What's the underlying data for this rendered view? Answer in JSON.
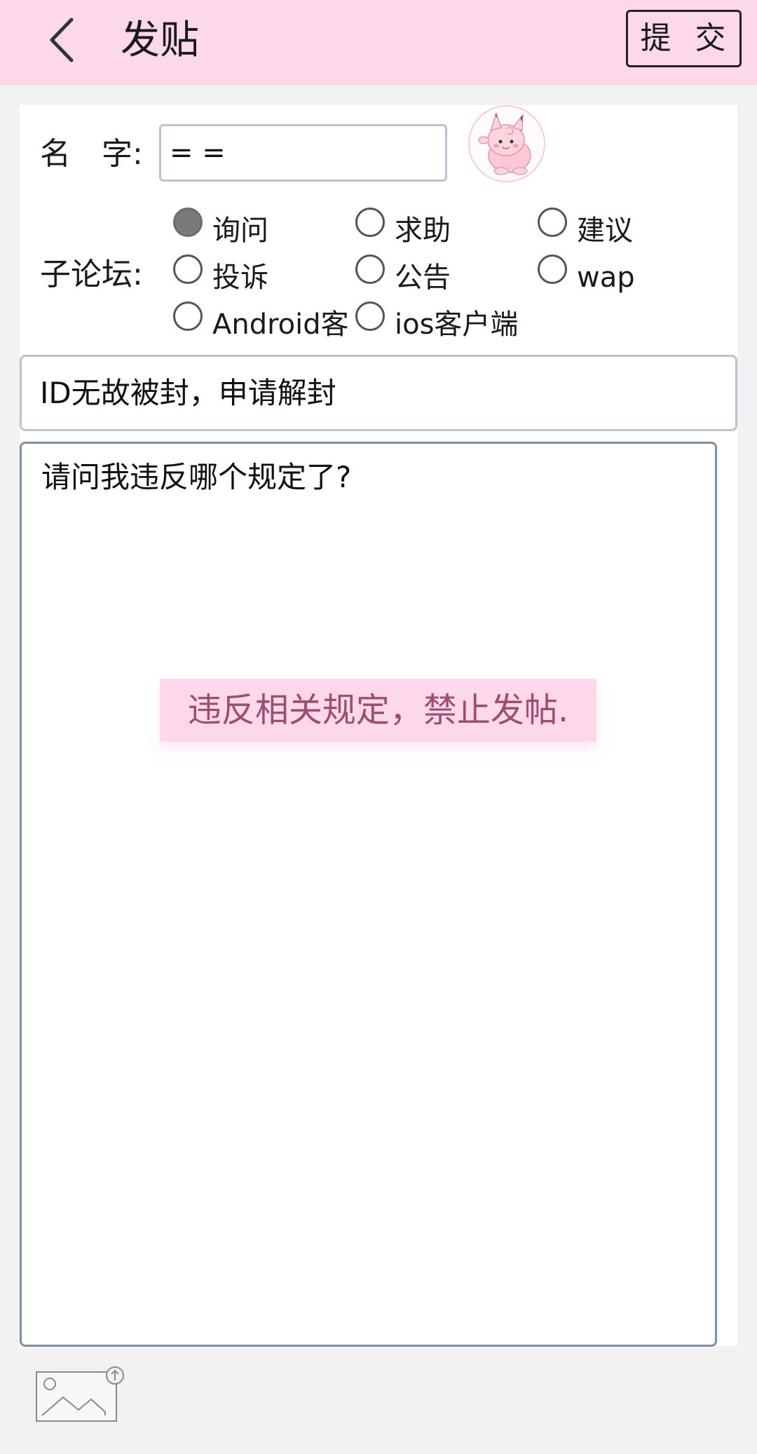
{
  "header": {
    "title": "发贴",
    "back_icon": "chevron-left-icon",
    "submit_label": "提 交",
    "background": "#fcd8ea"
  },
  "form": {
    "name_label_first": "名",
    "name_label_second": "字:",
    "name_value": "= =",
    "avatar_icon": "clefairy-avatar-icon",
    "forum_label": "子论坛:",
    "forums": [
      {
        "label": "询问",
        "checked": true
      },
      {
        "label": "求助",
        "checked": false
      },
      {
        "label": "建议",
        "checked": false
      },
      {
        "label": "投诉",
        "checked": false
      },
      {
        "label": "公告",
        "checked": false
      },
      {
        "label": "wap",
        "checked": false
      },
      {
        "label": "Android客",
        "checked": false
      },
      {
        "label": "ios客户端",
        "checked": false
      }
    ],
    "subject_value": "ID无故被封，申请解封",
    "content_value": "请问我违反哪个规定了?"
  },
  "toast": {
    "message": "违反相关规定，禁止发帖.",
    "color": "#9b4e72"
  },
  "footer": {
    "image_upload_icon": "image-upload-icon"
  }
}
